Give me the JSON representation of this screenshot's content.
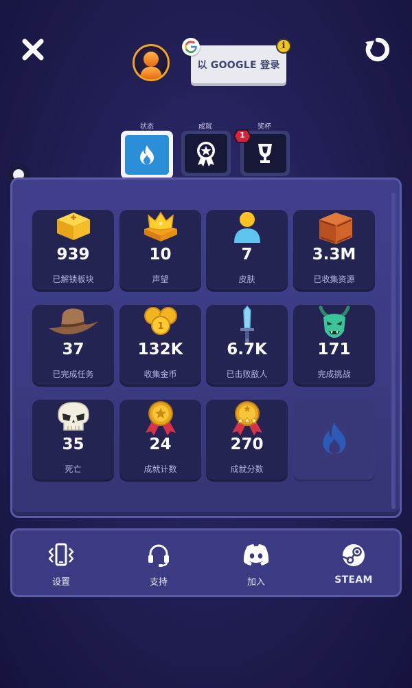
{
  "header": {
    "google_login_label": "以 GOOGLE 登录",
    "close_icon": "close-icon",
    "refresh_icon": "refresh-icon",
    "info_icon_text": "i"
  },
  "tabs": [
    {
      "label": "状态",
      "icon": "flame-icon",
      "active": true
    },
    {
      "label": "成就",
      "icon": "award-ribbon-icon",
      "active": false
    },
    {
      "label": "奖杯",
      "icon": "trophy-icon",
      "active": false,
      "badge": "1"
    }
  ],
  "stats": [
    {
      "value": "939",
      "label": "已解锁板块",
      "icon": "gold-block-icon"
    },
    {
      "value": "10",
      "label": "声望",
      "icon": "crown-icon"
    },
    {
      "value": "7",
      "label": "皮肤",
      "icon": "person-icon"
    },
    {
      "value": "3.3M",
      "label": "已收集资源",
      "icon": "crate-icon"
    },
    {
      "value": "37",
      "label": "已完成任务",
      "icon": "cowboy-hat-icon"
    },
    {
      "value": "132K",
      "label": "收集金币",
      "icon": "coins-icon"
    },
    {
      "value": "6.7K",
      "label": "已击败敌人",
      "icon": "sword-icon"
    },
    {
      "value": "171",
      "label": "完成挑战",
      "icon": "demon-icon"
    },
    {
      "value": "35",
      "label": "死亡",
      "icon": "skull-icon"
    },
    {
      "value": "24",
      "label": "成就计数",
      "icon": "medal-icon"
    },
    {
      "value": "270",
      "label": "成就分数",
      "icon": "medal-stars-icon"
    },
    {
      "value": "",
      "label": "",
      "icon": "flame-placeholder-icon"
    }
  ],
  "bottom_bar": [
    {
      "label": "设置",
      "icon": "phone-vibrate-icon"
    },
    {
      "label": "支持",
      "icon": "headset-icon"
    },
    {
      "label": "加入",
      "icon": "discord-icon"
    },
    {
      "label": "STEAM",
      "icon": "steam-icon"
    }
  ],
  "colors": {
    "background": "#232058",
    "panel": "#3b3a82",
    "card": "#242453",
    "tab_active": "#2b8fd8",
    "badge": "#d3243a",
    "avatar_ring": "#f3a51c",
    "label_text": "#b4b4e4"
  }
}
